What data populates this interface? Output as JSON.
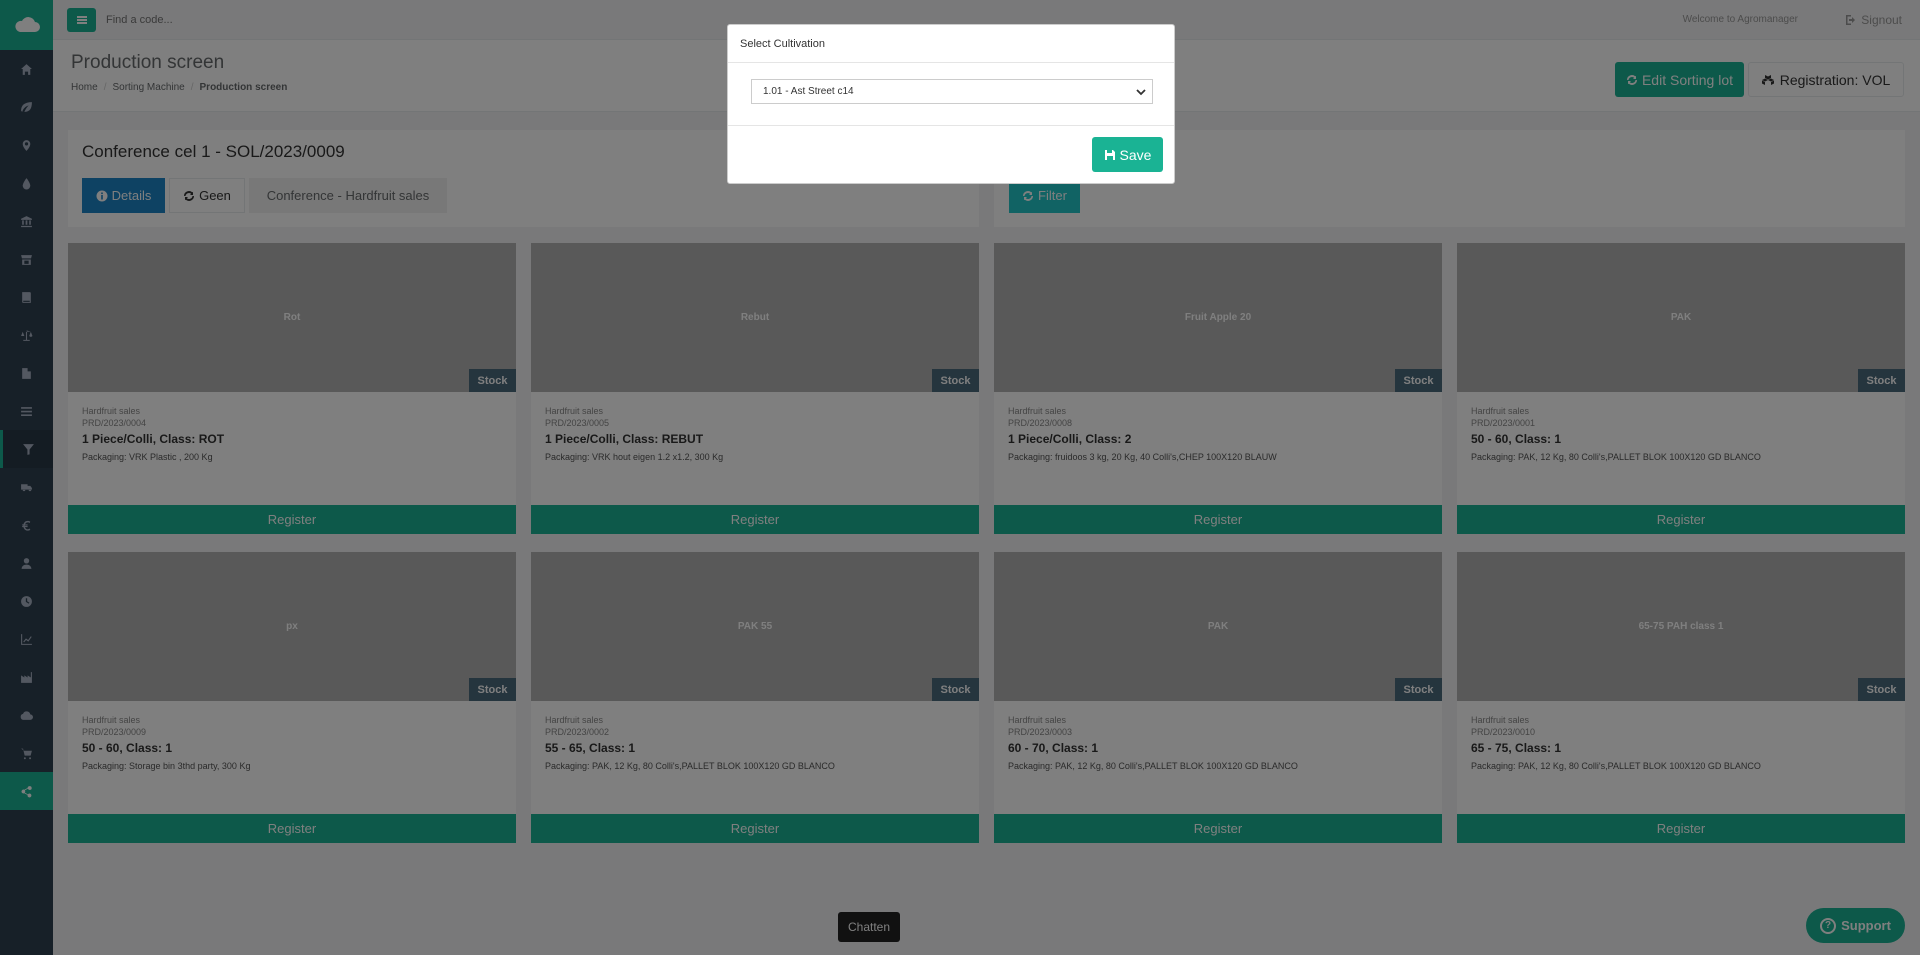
{
  "topbar": {
    "search_placeholder": "Find a code...",
    "welcome": "Welcome to Agromanager",
    "signout": "Signout"
  },
  "heading": {
    "title": "Production screen",
    "breadcrumb": [
      "Home",
      "Sorting Machine",
      "Production screen"
    ],
    "edit_button": "Edit Sorting lot",
    "registration_button": "Registration: VOL"
  },
  "info": {
    "title": "Conference cel 1 - SOL/2023/0009",
    "details_button": "Details",
    "geen_button": "Geen",
    "conference_button": "Conference - Hardfruit sales",
    "filter_button": "Filter"
  },
  "cards": [
    {
      "image_label": "Rot",
      "stock": "Stock",
      "category": "Hardfruit sales",
      "code": "PRD/2023/0004",
      "name": "1 Piece/Colli, Class: ROT",
      "packaging": "Packaging: VRK Plastic , 200 Kg",
      "register": "Register"
    },
    {
      "image_label": "Rebut",
      "stock": "Stock",
      "category": "Hardfruit sales",
      "code": "PRD/2023/0005",
      "name": "1 Piece/Colli, Class: REBUT",
      "packaging": "Packaging: VRK hout eigen 1.2 x1.2, 300 Kg",
      "register": "Register"
    },
    {
      "image_label": "Fruit Apple 20",
      "stock": "Stock",
      "category": "Hardfruit sales",
      "code": "PRD/2023/0008",
      "name": "1 Piece/Colli, Class: 2",
      "packaging": "Packaging: fruidoos 3 kg, 20 Kg, 40 Colli's,CHEP 100X120 BLAUW",
      "register": "Register"
    },
    {
      "image_label": "PAK",
      "stock": "Stock",
      "category": "Hardfruit sales",
      "code": "PRD/2023/0001",
      "name": "50 - 60, Class: 1",
      "packaging": "Packaging: PAK, 12 Kg, 80 Colli's,PALLET BLOK 100X120 GD BLANCO",
      "register": "Register"
    },
    {
      "image_label": "px",
      "stock": "Stock",
      "category": "Hardfruit sales",
      "code": "PRD/2023/0009",
      "name": "50 - 60, Class: 1",
      "packaging": "Packaging: Storage bin 3thd party, 300 Kg",
      "register": "Register"
    },
    {
      "image_label": "PAK 55",
      "stock": "Stock",
      "category": "Hardfruit sales",
      "code": "PRD/2023/0002",
      "name": "55 - 65, Class: 1",
      "packaging": "Packaging: PAK, 12 Kg, 80 Colli's,PALLET BLOK 100X120 GD BLANCO",
      "register": "Register"
    },
    {
      "image_label": "PAK",
      "stock": "Stock",
      "category": "Hardfruit sales",
      "code": "PRD/2023/0003",
      "name": "60 - 70, Class: 1",
      "packaging": "Packaging: PAK, 12 Kg, 80 Colli's,PALLET BLOK 100X120 GD BLANCO",
      "register": "Register"
    },
    {
      "image_label": "65-75 PAH class 1",
      "stock": "Stock",
      "category": "Hardfruit sales",
      "code": "PRD/2023/0010",
      "name": "65 - 75, Class: 1",
      "packaging": "Packaging: PAK, 12 Kg, 80 Colli's,PALLET BLOK 100X120 GD BLANCO",
      "register": "Register"
    }
  ],
  "modal": {
    "title": "Select Cultivation",
    "selected": "1.01 - Ast Street c14",
    "save_button": "Save"
  },
  "chat_label": "Chatten",
  "support_label": "Support",
  "sidebar_icons": [
    "home-icon",
    "leaf-icon",
    "map-marker-icon",
    "tint-icon",
    "bank-icon",
    "shop-icon",
    "book-icon",
    "scale-icon",
    "file-icon",
    "list-icon",
    "filter-icon",
    "truck-icon",
    "euro-icon",
    "user-icon",
    "clock-icon",
    "line-chart-icon",
    "industry-icon",
    "cloud-icon",
    "cart-icon",
    "share-icon"
  ],
  "colors": {
    "primary": "#1ab394",
    "info": "#1c84c6",
    "sidebar": "#2f4050"
  }
}
